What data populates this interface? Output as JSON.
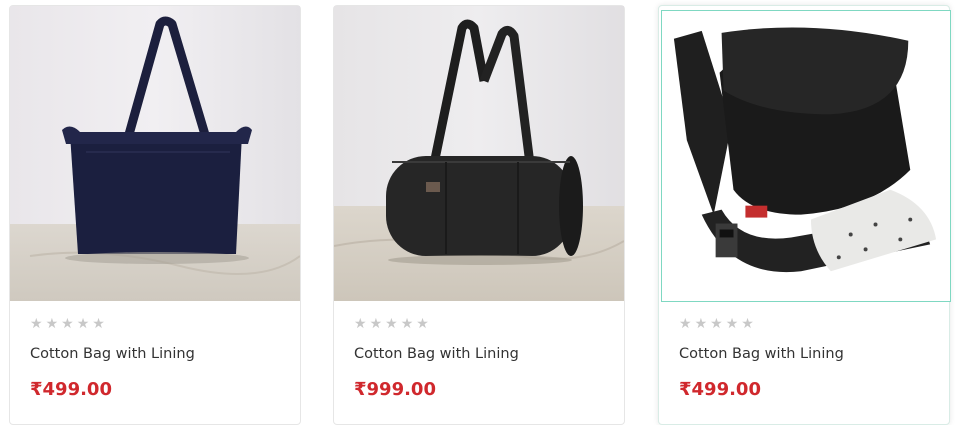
{
  "colors": {
    "price": "#d0282d",
    "star_empty": "#c8c8c8",
    "title": "#333333"
  },
  "products": [
    {
      "image_icon": "tote-bag-image",
      "rating": 0,
      "stars": [
        "★",
        "★",
        "★",
        "★",
        "★"
      ],
      "name": "Cotton Bag with Lining",
      "price": "₹499.00"
    },
    {
      "image_icon": "duffel-bag-image",
      "rating": 0,
      "stars": [
        "★",
        "★",
        "★",
        "★",
        "★"
      ],
      "name": "Cotton Bag with Lining",
      "price": "₹999.00"
    },
    {
      "image_icon": "messenger-bag-image",
      "rating": 0,
      "stars": [
        "★",
        "★",
        "★",
        "★",
        "★"
      ],
      "name": "Cotton Bag with Lining",
      "price": "₹499.00"
    }
  ]
}
